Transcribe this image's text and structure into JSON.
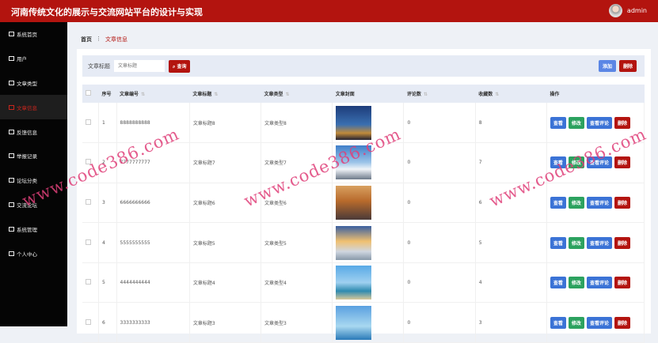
{
  "header": {
    "title": "河南传统文化的展示与交流网站平台的设计与实现",
    "user": "admin"
  },
  "sidebar": {
    "items": [
      {
        "label": "系统首页"
      },
      {
        "label": "用户"
      },
      {
        "label": "文章类型"
      },
      {
        "label": "文章信息"
      },
      {
        "label": "反馈信息"
      },
      {
        "label": "举报记录"
      },
      {
        "label": "论坛分类"
      },
      {
        "label": "交流论坛"
      },
      {
        "label": "系统管理"
      },
      {
        "label": "个人中心"
      }
    ],
    "active": "文章信息"
  },
  "breadcrumb": {
    "home": "首页",
    "sep": "⋮",
    "current": "文章信息"
  },
  "search": {
    "label": "文章标题",
    "placeholder": "文章标题",
    "query_label": "查询",
    "add_label": "添加",
    "delete_label": "删除"
  },
  "table": {
    "headers": [
      "序号",
      "文章编号",
      "文章标题",
      "文章类型",
      "文章封面",
      "评论数",
      "收藏数",
      "操作"
    ],
    "rows": [
      {
        "idx": "1",
        "code": "8888888888",
        "title": "文章标题8",
        "type": "文章类型8",
        "comments": "0",
        "favs": "8"
      },
      {
        "idx": "2",
        "code": "7777777777",
        "title": "文章标题7",
        "type": "文章类型7",
        "comments": "0",
        "favs": "7"
      },
      {
        "idx": "3",
        "code": "6666666666",
        "title": "文章标题6",
        "type": "文章类型6",
        "comments": "0",
        "favs": "6"
      },
      {
        "idx": "4",
        "code": "5555555555",
        "title": "文章标题5",
        "type": "文章类型5",
        "comments": "0",
        "favs": "5"
      },
      {
        "idx": "5",
        "code": "4444444444",
        "title": "文章标题4",
        "type": "文章类型4",
        "comments": "0",
        "favs": "4"
      },
      {
        "idx": "6",
        "code": "3333333333",
        "title": "文章标题3",
        "type": "文章类型3",
        "comments": "0",
        "favs": "3"
      }
    ],
    "ops": {
      "view": "查看",
      "edit": "修改",
      "comments": "查看评论",
      "delete": "删除"
    }
  },
  "watermark": "www.code386.com",
  "colors": {
    "brand": "#b3140f",
    "primary": "#3b73d6",
    "success": "#2ca25f"
  }
}
